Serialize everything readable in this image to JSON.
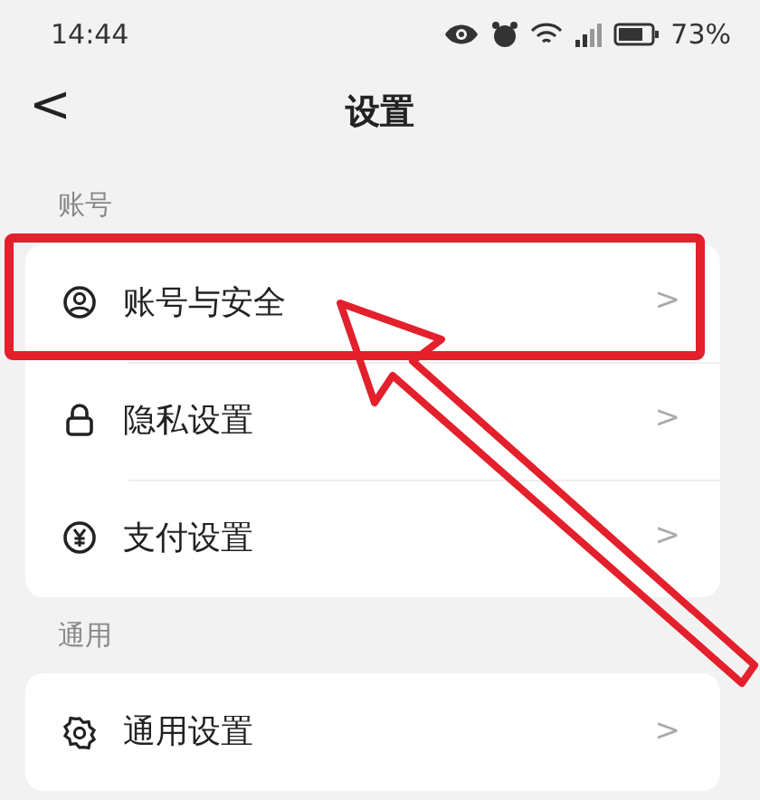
{
  "status_bar": {
    "time": "14:44",
    "battery": "73%"
  },
  "header": {
    "back": "<",
    "title": "设置"
  },
  "sections": [
    {
      "label": "账号",
      "items": [
        {
          "kind": "user",
          "label": "账号与安全",
          "chevron": ">",
          "highlighted": true
        },
        {
          "kind": "lock",
          "label": "隐私设置",
          "chevron": ">",
          "highlighted": false
        },
        {
          "kind": "yen",
          "label": "支付设置",
          "chevron": ">",
          "highlighted": false
        }
      ]
    },
    {
      "label": "通用",
      "items": [
        {
          "kind": "gear",
          "label": "通用设置",
          "chevron": ">",
          "highlighted": false
        }
      ]
    }
  ]
}
